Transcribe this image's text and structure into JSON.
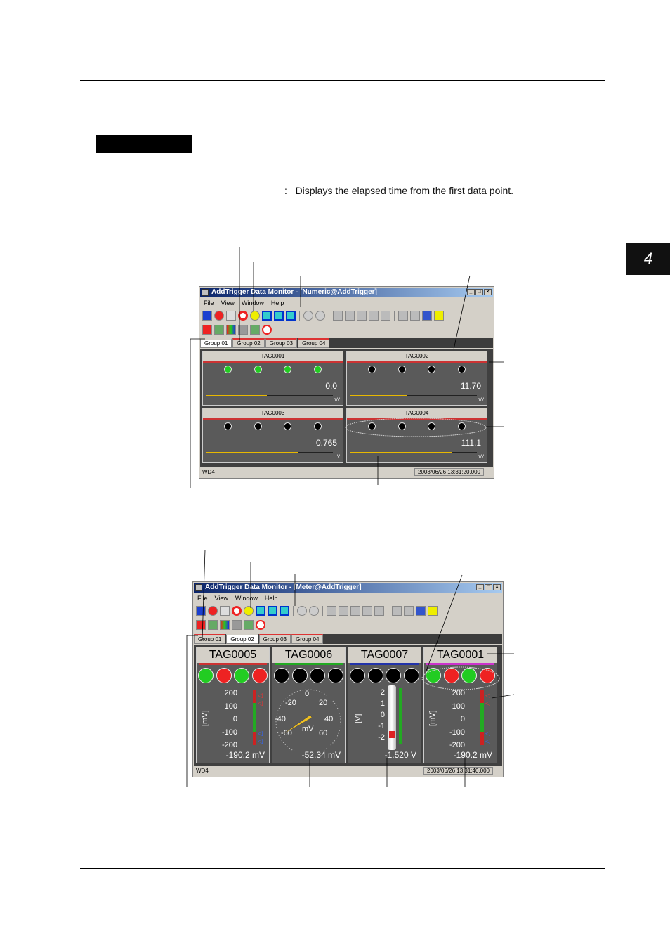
{
  "description_text": "Displays the elapsed time from the first data point.",
  "description_colon": ":",
  "chapter_number": "4",
  "window1": {
    "title": "AddTrigger Data Monitor - [Numeric@AddTrigger]",
    "menu": [
      "File",
      "View",
      "Window",
      "Help"
    ],
    "tabs": [
      "Group 01",
      "Group 02",
      "Group 03",
      "Group 04"
    ],
    "active_tab": 0,
    "panels": [
      {
        "tag": "TAG0001",
        "value": "0.0",
        "unit": "mV",
        "bar": 0.48
      },
      {
        "tag": "TAG0002",
        "value": "11.70",
        "unit": "mV",
        "bar": 0.45
      },
      {
        "tag": "TAG0003",
        "value": "0.765",
        "unit": "V",
        "bar": 0.72
      },
      {
        "tag": "TAG0004",
        "value": "111.1",
        "unit": "mV",
        "bar": 0.8
      }
    ],
    "status_left": "WD4",
    "status_time": "2003/06/26 13:31:20.000"
  },
  "window2": {
    "title": "AddTrigger Data Monitor - [Meter@AddTrigger]",
    "menu": [
      "File",
      "View",
      "Window",
      "Help"
    ],
    "tabs": [
      "Group 01",
      "Group 02",
      "Group 03",
      "Group 04"
    ],
    "active_tab": 1,
    "panels": [
      {
        "tag": "TAG0005",
        "value": "-190.2 mV",
        "scale": [
          "200",
          "100",
          "0",
          "-100",
          "-200"
        ],
        "unit": "[mV]"
      },
      {
        "tag": "TAG0006",
        "value": "-52.34 mV",
        "dial": [
          "0",
          "-20",
          "20",
          "-40",
          "40",
          "-60",
          "60"
        ],
        "unit": "mV"
      },
      {
        "tag": "TAG0007",
        "value": "-1.520 V",
        "scale": [
          "2",
          "1",
          "0",
          "-1",
          "-2"
        ],
        "unit": "[V]"
      },
      {
        "tag": "TAG0001",
        "value": "-190.2 mV",
        "scale": [
          "200",
          "100",
          "0",
          "-100",
          "-200"
        ],
        "unit": "[mV]"
      }
    ],
    "status_left": "WD4",
    "status_time": "2003/06/26 13:31:40.000"
  },
  "colors": {
    "lamp_green": "#22cc22",
    "lamp_red": "#ee2222",
    "lamp_black": "#000000",
    "bar_yellow": "#e8b800",
    "accent_red": "#cc3333",
    "accent_green": "#22aa22",
    "accent_blue": "#2233aa",
    "accent_magenta": "#cc33cc"
  }
}
